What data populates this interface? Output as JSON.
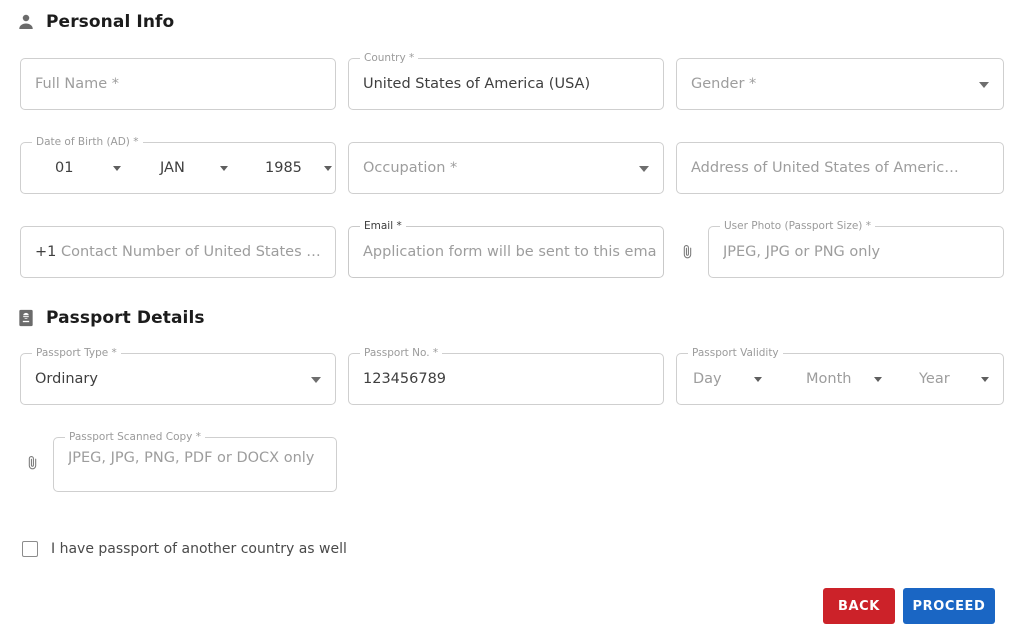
{
  "sections": [
    {
      "id": "personal",
      "title": "Personal Info",
      "icon": "person-icon"
    },
    {
      "id": "passport",
      "title": "Passport Details",
      "icon": "passport-book-icon"
    }
  ],
  "personal_info": {
    "full_name": {
      "label": "",
      "placeholder": "Full Name *",
      "value": ""
    },
    "country": {
      "label": "Country *",
      "placeholder": "",
      "value": "United States of America (USA)"
    },
    "gender": {
      "label": "",
      "placeholder": "Gender *",
      "value": "",
      "caret": "chevron-down-icon"
    },
    "date_of_birth": {
      "label": "Date of Birth (AD) *",
      "day": "01",
      "month": "JAN",
      "year": "1985"
    },
    "occupation": {
      "label": "",
      "placeholder": "Occupation *",
      "value": "",
      "caret": "chevron-down-icon"
    },
    "address": {
      "label": "",
      "placeholder": "Address of United States of Americ…",
      "value": ""
    },
    "contact": {
      "label": "",
      "prefix": "+1",
      "placeholder": "Contact Number of United States …",
      "value": ""
    },
    "email": {
      "label": "Email *",
      "placeholder": "Application form will be sent to this ema",
      "value": ""
    },
    "user_photo": {
      "label": "User Photo (Passport Size) *",
      "placeholder": "JPEG, JPG or PNG only",
      "icon": "paperclip-icon"
    }
  },
  "passport_details": {
    "passport_type": {
      "label": "Passport Type *",
      "value": "Ordinary",
      "caret": "chevron-down-icon"
    },
    "passport_no": {
      "label": "Passport No. *",
      "value": "123456789"
    },
    "passport_validity": {
      "label": "Passport Validity",
      "day": "Day",
      "month": "Month",
      "year": "Year"
    },
    "scanned_copy": {
      "label": "Passport Scanned Copy *",
      "placeholder": "JPEG, JPG, PNG, PDF or DOCX only",
      "icon": "paperclip-icon"
    }
  },
  "checkbox": {
    "label": "I have passport of another country as well",
    "checked": false
  },
  "actions": {
    "back": "BACK",
    "proceed": "PROCEED"
  },
  "colors": {
    "back_bg": "#cc2229",
    "proceed_bg": "#1a66c4",
    "border": "#cfcfcf",
    "label": "#9b9b9b",
    "placeholder": "#9d9d9d",
    "value": "#3f3f3f",
    "heading": "#1c1c1c",
    "icon_gray": "#6b6b6b"
  }
}
